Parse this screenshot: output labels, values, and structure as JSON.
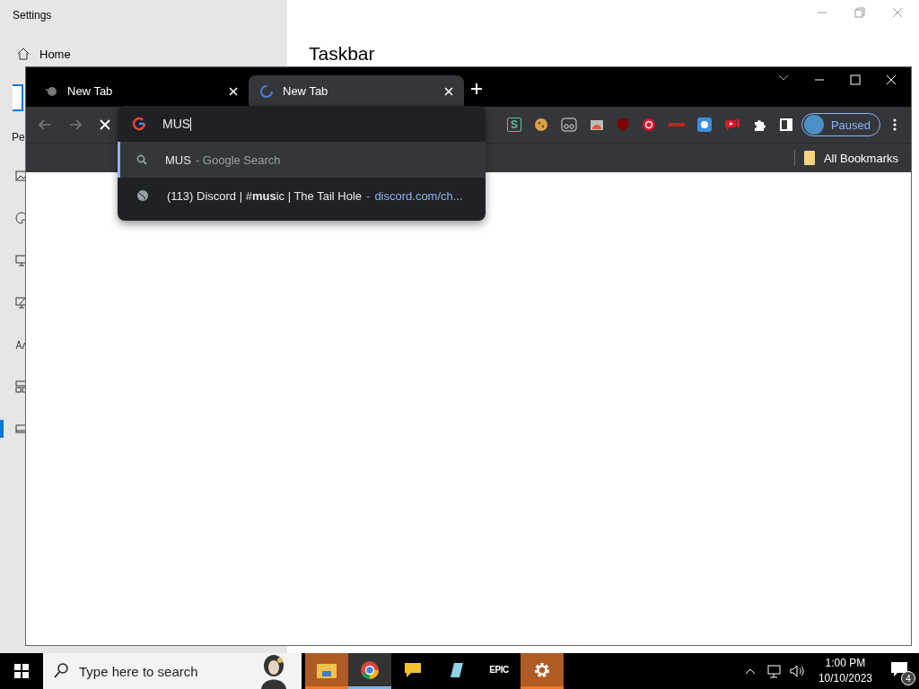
{
  "settings_window": {
    "title": "Settings",
    "nav_label": "Home",
    "heading": "Taskbar",
    "section_label": "Pe",
    "nav_icons": [
      {
        "kind": "image",
        "selected": false
      },
      {
        "kind": "palette",
        "selected": false
      },
      {
        "kind": "monitor",
        "selected": false
      },
      {
        "kind": "monitor-pen",
        "selected": false
      },
      {
        "kind": "font",
        "selected": false
      },
      {
        "kind": "grid",
        "selected": false
      },
      {
        "kind": "taskbar",
        "selected": true
      }
    ]
  },
  "browser": {
    "tabs": [
      {
        "title": "New Tab",
        "selected": false,
        "loading": false
      },
      {
        "title": "New Tab",
        "selected": true,
        "loading": true
      }
    ],
    "omnibox": {
      "value": "MUS"
    },
    "suggestions": [
      {
        "kind": "search",
        "text": "MUS",
        "hint": "- Google Search",
        "selected": true
      },
      {
        "kind": "history",
        "text": "(113) Discord | #**mus**ic | The Tail Hole",
        "hint": "-",
        "url": "discord.com/ch...",
        "selected": false
      }
    ],
    "extensions": [
      {
        "kind": "letter",
        "label": "S"
      },
      {
        "kind": "cookie"
      },
      {
        "kind": "eyes"
      },
      {
        "kind": "gallery"
      },
      {
        "kind": "shield"
      },
      {
        "kind": "red-circle"
      },
      {
        "kind": "red-bar"
      },
      {
        "kind": "blue-square"
      },
      {
        "kind": "red-play"
      },
      {
        "kind": "puzzle"
      },
      {
        "kind": "sidepanel"
      }
    ],
    "profile": {
      "label": "Paused"
    },
    "bookmarks": [
      {
        "label": "All Bookmarks"
      }
    ]
  },
  "taskbar": {
    "search": {
      "placeholder": "Type here to search"
    },
    "apps": [
      {
        "kind": "folder",
        "selected": false,
        "highlighted": true
      },
      {
        "kind": "chrome",
        "selected": true,
        "highlighted": false
      },
      {
        "kind": "chat",
        "selected": false,
        "highlighted": false
      },
      {
        "kind": "crystal",
        "selected": false,
        "highlighted": false
      },
      {
        "kind": "epic",
        "label": "EPIC",
        "selected": false,
        "highlighted": false
      },
      {
        "kind": "gear",
        "selected": false,
        "highlighted": true
      }
    ],
    "time": "1:00 PM",
    "date": "10/10/2023",
    "notification_count": "4"
  }
}
